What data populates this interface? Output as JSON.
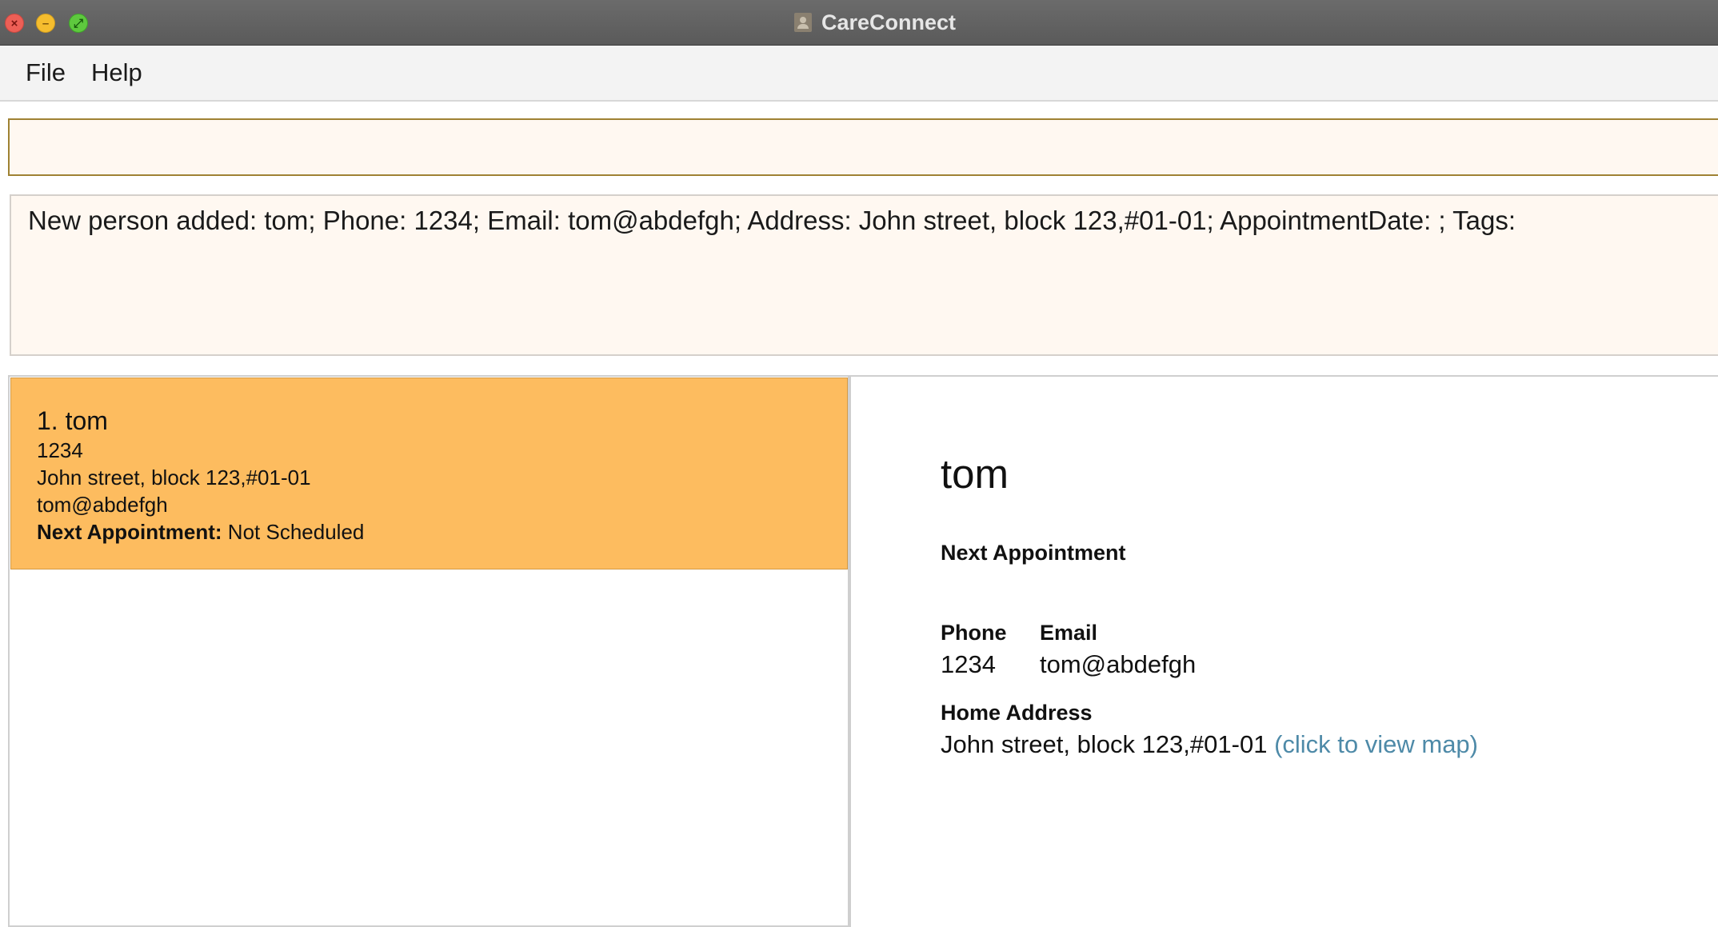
{
  "window": {
    "title": "CareConnect"
  },
  "menu": {
    "items": [
      "File",
      "Help"
    ]
  },
  "command_box": {
    "value": "",
    "placeholder": ""
  },
  "result_display": {
    "text": "New person added: tom; Phone: 1234; Email: tom@abdefgh; Address: John street, block 123,#01-01; AppointmentDate: ; Tags:"
  },
  "person_list": {
    "selected_index": 0,
    "items": [
      {
        "index_name": "1. tom",
        "phone": "1234",
        "address": "John street, block 123,#01-01",
        "email": "tom@abdefgh",
        "appointment_label": "Next Appointment:",
        "appointment_value": " Not Scheduled"
      }
    ]
  },
  "details": {
    "name": "tom",
    "appointment_label": "Next Appointment",
    "phone_label": "Phone",
    "phone": "1234",
    "email_label": "Email",
    "email": "tom@abdefgh",
    "address_label": "Home Address",
    "address": "John street, block 123,#01-01",
    "map_link": "(click to view map)"
  },
  "colors": {
    "selected_card": "#fdbc5f",
    "panel_background": "#fff8f1",
    "command_border": "#9f8233",
    "link": "#4e8aa8",
    "titlebar": "#5f5f5f"
  }
}
